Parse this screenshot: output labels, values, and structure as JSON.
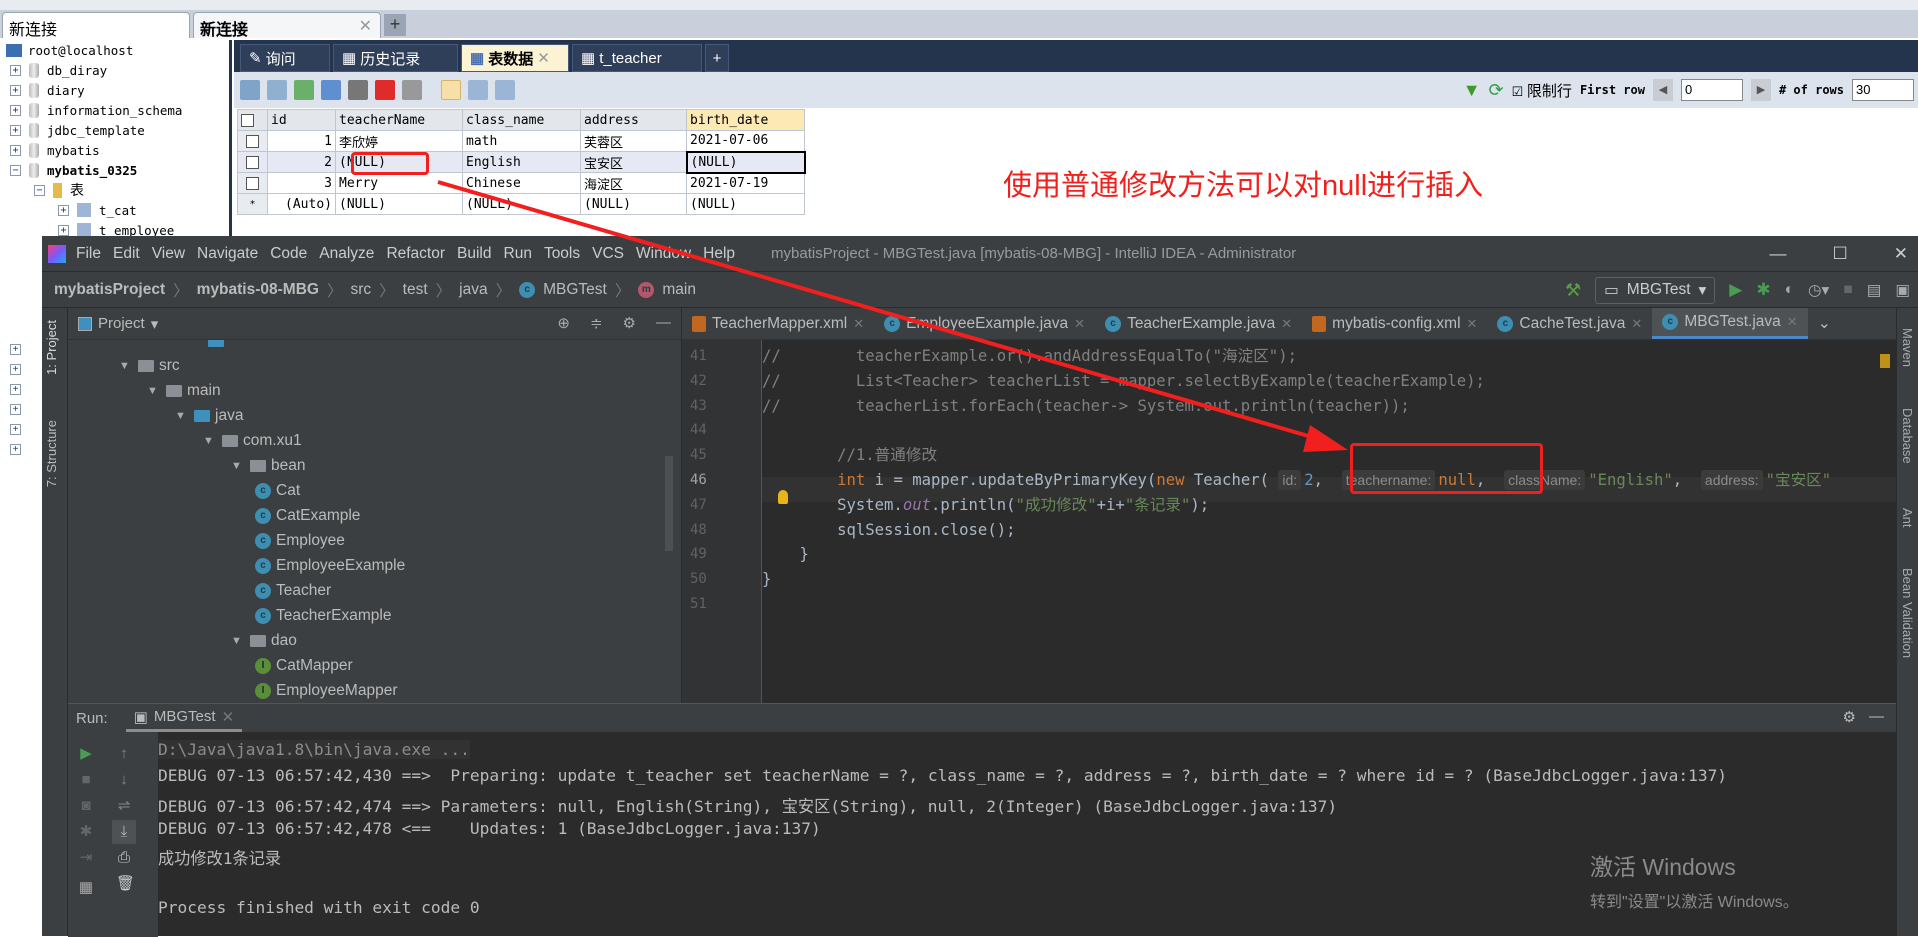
{
  "sqlyog": {
    "connection_tabs": [
      "新连接",
      "新连接"
    ],
    "tree": {
      "root": "root@localhost",
      "databases": [
        "db_diray",
        "diary",
        "information_schema",
        "jdbc_template",
        "mybatis",
        "mybatis_0325"
      ],
      "folder": "表",
      "tables": [
        "t_cat",
        "t_employee"
      ]
    },
    "tabs": [
      "询问",
      "历史记录",
      "表数据",
      "t_teacher"
    ],
    "toolbar": {
      "limit_label": "限制行",
      "limit_checked": true,
      "first_row_label": "First row",
      "first_row_value": "0",
      "rows_label": "# of rows",
      "rows_value": "30"
    },
    "grid": {
      "columns": [
        "id",
        "teacherName",
        "class_name",
        "address",
        "birth_date"
      ],
      "rows": [
        [
          "1",
          "李欣婷",
          "math",
          "芙蓉区",
          "2021-07-06"
        ],
        [
          "2",
          "(NULL)",
          "English",
          "宝安区",
          "(NULL)"
        ],
        [
          "3",
          "Merry",
          "Chinese",
          "海淀区",
          "2021-07-19"
        ],
        [
          "(Auto)",
          "(NULL)",
          "(NULL)",
          "(NULL)",
          "(NULL)"
        ]
      ]
    }
  },
  "annotation": "使用普通修改方法可以对null进行插入",
  "idea": {
    "menu": [
      "File",
      "Edit",
      "View",
      "Navigate",
      "Code",
      "Analyze",
      "Refactor",
      "Build",
      "Run",
      "Tools",
      "VCS",
      "Window",
      "Help"
    ],
    "window_title": "mybatisProject - MBGTest.java [mybatis-08-MBG] - IntelliJ IDEA - Administrator",
    "breadcrumbs": [
      "mybatisProject",
      "mybatis-08-MBG",
      "src",
      "test",
      "java",
      "MBGTest",
      "main"
    ],
    "run_config": "MBGTest",
    "left_tabs": [
      "1: Project",
      "7: Structure"
    ],
    "right_tabs": [
      "Maven",
      "Database",
      "Ant",
      "Bean Validation"
    ],
    "project_label": "Project",
    "project_tree": [
      {
        "label": "src",
        "depth": 0,
        "type": "folder"
      },
      {
        "label": "main",
        "depth": 1,
        "type": "folder"
      },
      {
        "label": "java",
        "depth": 2,
        "type": "source"
      },
      {
        "label": "com.xu1",
        "depth": 3,
        "type": "package"
      },
      {
        "label": "bean",
        "depth": 4,
        "type": "package"
      },
      {
        "label": "Cat",
        "depth": 5,
        "type": "class"
      },
      {
        "label": "CatExample",
        "depth": 5,
        "type": "class"
      },
      {
        "label": "Employee",
        "depth": 5,
        "type": "class"
      },
      {
        "label": "EmployeeExample",
        "depth": 5,
        "type": "class"
      },
      {
        "label": "Teacher",
        "depth": 5,
        "type": "class"
      },
      {
        "label": "TeacherExample",
        "depth": 5,
        "type": "class"
      },
      {
        "label": "dao",
        "depth": 4,
        "type": "package"
      },
      {
        "label": "CatMapper",
        "depth": 5,
        "type": "interface"
      },
      {
        "label": "EmployeeMapper",
        "depth": 5,
        "type": "interface"
      }
    ],
    "editor_tabs": [
      {
        "label": "TeacherMapper.xml",
        "icon": "xml",
        "active": false
      },
      {
        "label": "EmployeeExample.java",
        "icon": "class",
        "active": false
      },
      {
        "label": "TeacherExample.java",
        "icon": "class",
        "active": false
      },
      {
        "label": "mybatis-config.xml",
        "icon": "xml",
        "active": false
      },
      {
        "label": "CacheTest.java",
        "icon": "class",
        "active": false
      },
      {
        "label": "MBGTest.java",
        "icon": "class",
        "active": true
      }
    ],
    "code": [
      {
        "n": "41",
        "tokens": [
          [
            "cm",
            "//        teacherExample.or().andAddressEqualTo(\"海淀区\");"
          ]
        ]
      },
      {
        "n": "42",
        "tokens": [
          [
            "cm",
            "//        List<Teacher> teacherList = mapper.selectByExample(teacherExample);"
          ]
        ]
      },
      {
        "n": "43",
        "tokens": [
          [
            "cm",
            "//        teacherList.forEach(teacher-> System.out.println(teacher));"
          ]
        ]
      },
      {
        "n": "44",
        "tokens": []
      },
      {
        "n": "45",
        "tokens": [
          [
            "cm",
            "        //1.普通修改"
          ]
        ]
      },
      {
        "n": "46",
        "tokens": [
          [
            "p",
            "        "
          ],
          [
            "kw",
            "int"
          ],
          [
            "p",
            " i = mapper.updateByPrimaryKey("
          ],
          [
            "kw",
            "new"
          ],
          [
            "p",
            " Teacher( "
          ],
          [
            "hint",
            "id:"
          ],
          [
            "num",
            "2"
          ],
          [
            "p",
            ",  "
          ],
          [
            "hint",
            "teachername:"
          ],
          [
            "kw",
            "null"
          ],
          [
            "p",
            ",  "
          ],
          [
            "hint",
            "className:"
          ],
          [
            "str",
            "\"English\""
          ],
          [
            "p",
            ",  "
          ],
          [
            "hint",
            "address:"
          ],
          [
            "str",
            "\"宝安区\""
          ]
        ]
      },
      {
        "n": "47",
        "tokens": [
          [
            "p",
            "        System."
          ],
          [
            "field",
            "out"
          ],
          [
            "p",
            ".println("
          ],
          [
            "str",
            "\"成功修改\""
          ],
          [
            "p",
            "+i+"
          ],
          [
            "str",
            "\"条记录\""
          ],
          [
            "p",
            ");"
          ]
        ]
      },
      {
        "n": "48",
        "tokens": [
          [
            "p",
            "        sqlSession.close();"
          ]
        ]
      },
      {
        "n": "49",
        "tokens": [
          [
            "p",
            "    }"
          ]
        ]
      },
      {
        "n": "50",
        "tokens": [
          [
            "p",
            "}"
          ]
        ]
      },
      {
        "n": "51",
        "tokens": []
      }
    ],
    "run": {
      "label": "Run:",
      "tab": "MBGTest",
      "console": [
        "D:\\Java\\java1.8\\bin\\java.exe ...",
        "DEBUG 07-13 06:57:42,430 ==>  Preparing: update t_teacher set teacherName = ?, class_name = ?, address = ?, birth_date = ? where id = ? (BaseJdbcLogger.java:137)",
        "DEBUG 07-13 06:57:42,474 ==> Parameters: null, English(String), 宝安区(String), null, 2(Integer) (BaseJdbcLogger.java:137)",
        "DEBUG 07-13 06:57:42,478 <==    Updates: 1 (BaseJdbcLogger.java:137)",
        "成功修改1条记录",
        "",
        "Process finished with exit code 0"
      ]
    }
  },
  "watermark": [
    "激活 Windows",
    "转到\"设置\"以激活 Windows。"
  ],
  "colors": {
    "annotation": "#f0201c",
    "editor_bg": "#2b2b2b",
    "keyword": "#cc7832",
    "string": "#6a8759",
    "comment": "#808080"
  }
}
